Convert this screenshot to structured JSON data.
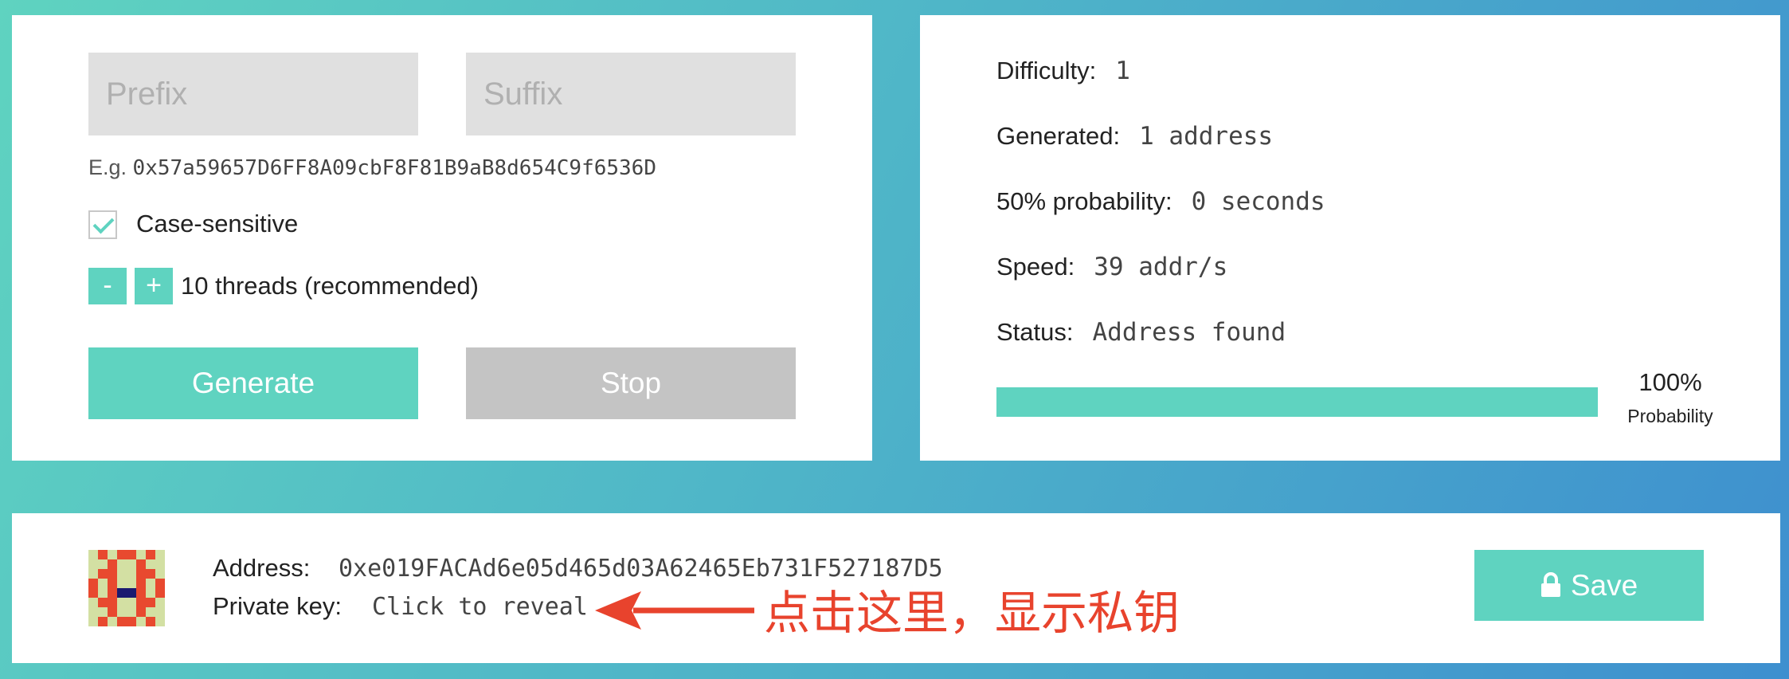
{
  "form": {
    "prefix_placeholder": "Prefix",
    "suffix_placeholder": "Suffix",
    "example_prefix": "E.g.",
    "example_address": "0x57a59657D6FF8A09cbF8F81B9aB8d654C9f6536D",
    "case_sensitive_label": "Case-sensitive",
    "case_sensitive_checked": true,
    "minus_label": "-",
    "plus_label": "+",
    "threads_label": "10 threads (recommended)",
    "generate_label": "Generate",
    "stop_label": "Stop"
  },
  "stats": {
    "difficulty_label": "Difficulty:",
    "difficulty_value": "1",
    "generated_label": "Generated:",
    "generated_value": "1 address",
    "probability_label": "50% probability:",
    "probability_value": "0 seconds",
    "speed_label": "Speed:",
    "speed_value": "39 addr/s",
    "status_label": "Status:",
    "status_value": "Address found",
    "progress_percent_text": "100%",
    "progress_fraction": 1.0,
    "progress_caption": "Probability"
  },
  "result": {
    "address_label": "Address:",
    "address_value": "0xe019FACAd6e05d465d03A62465Eb731F527187D5",
    "private_key_label": "Private key:",
    "private_key_value": "Click to reveal",
    "save_label": "Save",
    "annotation_text": "点击这里，显示私钥",
    "save_icon": "lock-icon",
    "identicon_colors": [
      "#e8492f",
      "#d3e0a3",
      "#1a1a70"
    ]
  },
  "colors": {
    "accent": "#5fd3c0",
    "disabled": "#c4c4c4",
    "annotation": "#e8432d"
  }
}
